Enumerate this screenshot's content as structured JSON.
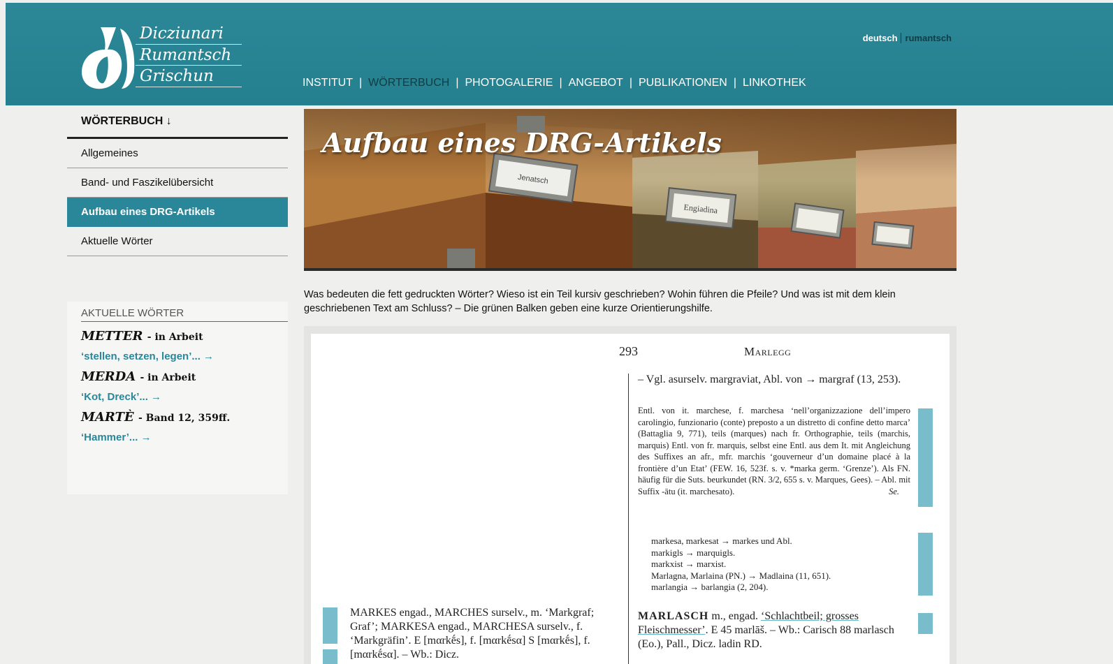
{
  "header": {
    "logo_lines": [
      "Dicziunari",
      "Rumantsch",
      "Grischun"
    ],
    "lang": {
      "deutsch": "deutsch",
      "rumantsch": "rumantsch"
    },
    "nav": [
      {
        "label": "INSTITUT",
        "active": false
      },
      {
        "label": "WÖRTERBUCH",
        "active": true
      },
      {
        "label": "PHOTOGALERIE",
        "active": false
      },
      {
        "label": "ANGEBOT",
        "active": false
      },
      {
        "label": "PUBLIKATIONEN",
        "active": false
      },
      {
        "label": "LINKOTHEK",
        "active": false
      }
    ],
    "nav_separator": "|"
  },
  "sidebar": {
    "heading": "WÖRTERBUCH ↓",
    "items": [
      {
        "label": "Allgemeines",
        "active": false
      },
      {
        "label": "Band- und Faszikelübersicht",
        "active": false
      },
      {
        "label": "Aufbau eines DRG-Artikels",
        "active": true
      },
      {
        "label": "Aktuelle Wörter",
        "active": false
      }
    ]
  },
  "aktuelle": {
    "heading": "AKTUELLE WÖRTER",
    "words": [
      {
        "word": "METTER",
        "status": "- in Arbeit",
        "gloss": "‘stellen, setzen, legen’... →"
      },
      {
        "word": "MERDA",
        "status": "- in Arbeit",
        "gloss": "‘Kot, Dreck’... →"
      },
      {
        "word": "MARTÈ",
        "status": "- Band 12, 359ff.",
        "gloss": "‘Hammer’... →"
      }
    ]
  },
  "banner": {
    "title": "Aufbau eines DRG-Artikels",
    "box_labels": [
      "Jenatsch",
      "Engiadina"
    ]
  },
  "intro": "Was bedeuten die fett gedruckten Wörter? Wieso ist ein Teil kursiv geschrieben? Wohin führen die Pfeile? Und was ist mit dem klein geschriebenen Text am Schluss? – Die grünen Balken geben eine kurze Orientierungshilfe.",
  "doc": {
    "page_number": "293",
    "running_head": "Marlegg",
    "p1": "– Vgl. asurselv. margraviat, Abl. von → margraf (13, 253).",
    "p2": "Entl. von it. marchese, f. marchesa ‘nell’organizzazione dell’impero carolingio, funzionario (conte) preposto a un distretto di confine detto marca’ (Battaglia 9, 771), teils (marques) nach fr. Orthographie, teils (marchis, marquis) Entl. von fr. marquis, selbst eine Entl. aus dem It. mit Angleichung des Suffixes an afr., mfr. marchis ‘gouverneur d’un domaine placé à la frontière d’un Etat’ (FEW. 16, 523f. s. v. *marka germ. ‘Grenze’). Als FN. häufig für die Suts. beurkundet (RN. 3/2, 655 s. v. Marques, Gees). – Abl. mit Suffix -ātu (it. marchesato).",
    "p2_signature": "Se.",
    "refs": [
      "markesa, markesat → markes und Abl.",
      "markigls → marquigls.",
      "markxist → marxist.",
      "Marlagna, Marlaina (PN.) → Madlaina (11, 651).",
      "marlangia → barlangia (2, 204)."
    ],
    "entry_right_headword": "MARLASCH",
    "entry_right_gram": " m., engad. ",
    "entry_right_gloss": "‘Schlachtbeil; grosses Fleischmesser’",
    "entry_right_rest": ". E 45 marlāš. – Wb.: Carisch 88 marlasch (Eo.), Pall., Dicz. ladin RD.",
    "entry_left": "MARKES engad., MARCHES surselv., m. ‘Markgraf; Graf’; MARKESA engad., MARCHESA surselv., f. ‘Markgräfin’. E [mαrkḗs], f. [mαrkḗsα] S [mαrkḗs], f. [mαrkḗsα]. – Wb.: Dicz."
  },
  "colors": {
    "header": "#2a8595",
    "accent": "#2a8699",
    "bar": "#79bccb",
    "background": "#efefed"
  }
}
